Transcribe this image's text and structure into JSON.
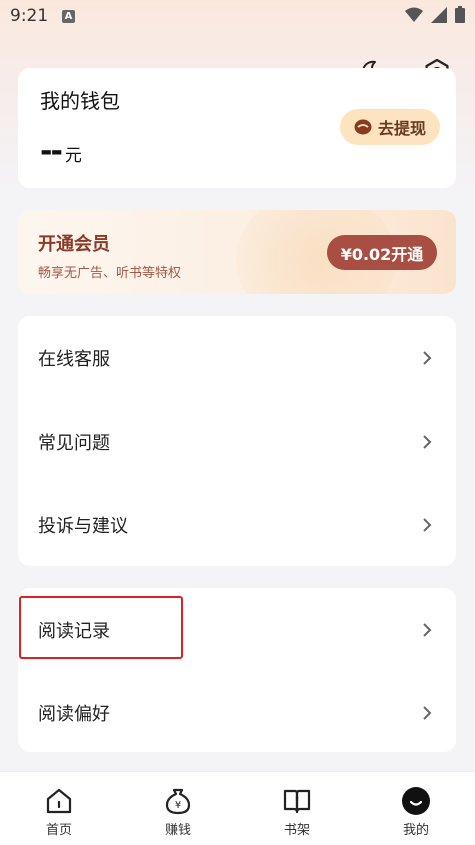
{
  "status_bar": {
    "time": "9:21",
    "notification_icon": "A"
  },
  "header": {
    "icons": [
      "moon-icon",
      "settings-icon"
    ]
  },
  "wallet": {
    "title": "我的钱包",
    "balance": "--",
    "unit": "元",
    "withdraw_label": "去提现"
  },
  "vip": {
    "title": "开通会员",
    "subtitle": "畅享无广告、听书等特权",
    "button_label": "¥0.02开通"
  },
  "menu_group_1": [
    {
      "label": "在线客服"
    },
    {
      "label": "常见问题"
    },
    {
      "label": "投诉与建议"
    }
  ],
  "menu_group_2": [
    {
      "label": "阅读记录"
    },
    {
      "label": "阅读偏好"
    }
  ],
  "bottom_nav": [
    {
      "label": "首页",
      "icon": "home-icon"
    },
    {
      "label": "赚钱",
      "icon": "money-bag-icon"
    },
    {
      "label": "书架",
      "icon": "bookshelf-icon"
    },
    {
      "label": "我的",
      "icon": "profile-icon",
      "active": true
    }
  ],
  "colors": {
    "accent_brown": "#a84e43",
    "highlight_red": "#e02020",
    "withdraw_bg": "#fde4bf"
  }
}
